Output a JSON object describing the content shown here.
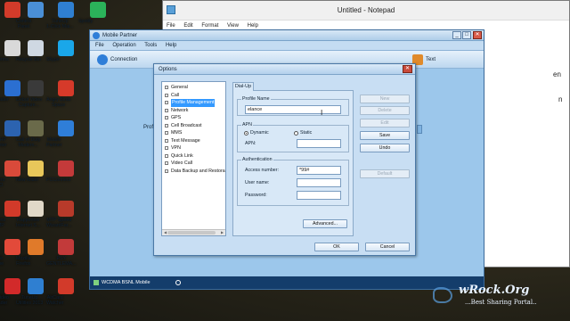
{
  "desktop_icons": [
    {
      "label": "",
      "color": "#d23b2a"
    },
    {
      "label": "Control\nPanel",
      "color": "#4a8fd6"
    },
    {
      "label": "TuneUp\n1-Click Mai...",
      "color": "#2f7fd1"
    },
    {
      "label": "Spotify",
      "color": "#2bb35a"
    },
    {
      "label": "ryforms",
      "color": "#d9d9d9"
    },
    {
      "label": "Recycle Bin",
      "color": "#cfd8e2"
    },
    {
      "label": "Skype",
      "color": "#1aa7e9"
    },
    {
      "label": "nloader",
      "color": "#2b6fd1"
    },
    {
      "label": "Debut Video\nCapture...",
      "color": "#3a3a3a"
    },
    {
      "label": "Angry Birds\nSpace",
      "color": "#d63a2a"
    },
    {
      "label": "ce HP\nPrinter",
      "color": "#2c63b0"
    },
    {
      "label": "Call of Duty\nModern...",
      "color": "#6a6a4a"
    },
    {
      "label": "Mobile\nPartner",
      "color": "#2f7ed8"
    },
    {
      "label": "agero\nISO",
      "color": "#d94a3a"
    },
    {
      "label": "New folder",
      "color": "#e8c75a"
    },
    {
      "label": "PCConnect",
      "color": "#c43a3a"
    },
    {
      "label": "ptions\nAMP",
      "color": "#d23a2a"
    },
    {
      "label": "Rapportive\nInternet S...",
      "color": "#e0d8c8"
    },
    {
      "label": "MTP Speed\nWizardFar...",
      "color": "#b83a2a"
    },
    {
      "label": "ogle\nrome",
      "color": "#e24a3a"
    },
    {
      "label": "Mozilla\nFirefox",
      "color": "#e07a2a"
    },
    {
      "label": "PSY\nGENTLEMA...",
      "color": "#c23a3a"
    },
    {
      "label": "n Video\nloader",
      "color": "#d22a2a"
    },
    {
      "label": "TuneUp\nUtilities 2013",
      "color": "#2f7fd1"
    },
    {
      "label": "AirCard\nWatcher",
      "color": "#d23a2a"
    }
  ],
  "notepad": {
    "title": "Untitled - Notepad",
    "menu": [
      "File",
      "Edit",
      "Format",
      "View",
      "Help"
    ],
    "fragments": [
      "en",
      "n"
    ]
  },
  "mobile_partner": {
    "title": "Mobile Partner",
    "menu": [
      "File",
      "Operation",
      "Tools",
      "Help"
    ],
    "toolbar": [
      {
        "label": "Connection",
        "icon": "connection-icon"
      },
      {
        "label": "Text",
        "icon": "text-icon"
      }
    ],
    "side_label": "Profile",
    "status": "WCDMA  BSNL Mobile",
    "window_controls": [
      "_",
      "□",
      "✕"
    ]
  },
  "options": {
    "title": "Options",
    "close": "✕",
    "tree": [
      {
        "label": "General",
        "selected": false
      },
      {
        "label": "Call",
        "selected": false
      },
      {
        "label": "Profile Management",
        "selected": true
      },
      {
        "label": "Network",
        "selected": false
      },
      {
        "label": "GPS",
        "selected": false
      },
      {
        "label": "Cell Broadcast",
        "selected": false
      },
      {
        "label": "MMS",
        "selected": false
      },
      {
        "label": "Text Message",
        "selected": false
      },
      {
        "label": "VPN",
        "selected": false
      },
      {
        "label": "Quick Link",
        "selected": false
      },
      {
        "label": "Video Call",
        "selected": false
      },
      {
        "label": "Data Backup and Restora",
        "selected": false
      }
    ],
    "tab": "Dial-Up",
    "profile_name_group": "Profile Name",
    "profile_name_value": "elance",
    "apn_group": "APN",
    "apn_dynamic": "Dynamic",
    "apn_static": "Static",
    "apn_label": "APN:",
    "apn_value": "",
    "auth_group": "Authentication",
    "access_number_label": "Access number:",
    "access_number_value": "*99#",
    "username_label": "User name:",
    "username_value": "",
    "password_label": "Password:",
    "password_value": "",
    "advanced_button": "Advanced...",
    "side_buttons": {
      "new": "New",
      "delete": "Delete",
      "edit": "Edit",
      "save": "Save",
      "undo": "Undo",
      "default": "Default"
    },
    "ok": "OK",
    "cancel": "Cancel"
  },
  "watermark": {
    "brand": "wRock.Org",
    "tagline": "...Best Sharing Portal.."
  }
}
